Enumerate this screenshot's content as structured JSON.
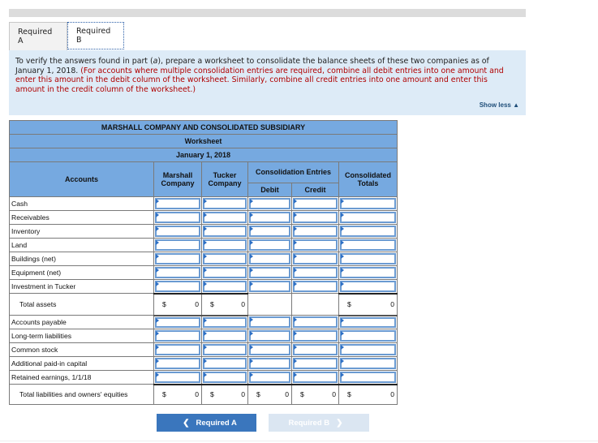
{
  "tabs": [
    {
      "label": "Required A",
      "active": false
    },
    {
      "label": "Required B",
      "active": true
    }
  ],
  "instructions": {
    "text_plain_1": "To verify the answers found in part (",
    "text_italic": "a",
    "text_plain_2": "), prepare a worksheet to consolidate the balance sheets of these two companies as of January 1, 2018. ",
    "text_red": "(For accounts where multiple consolidation entries are required, combine all debit entries into one amount and enter this amount in the debit column of the worksheet. Similarly, combine all credit entries into one amount and enter this amount in the credit column of the worksheet.)",
    "show_less_label": "Show less",
    "show_less_icon": "triangle-up-icon"
  },
  "worksheet": {
    "title": "MARSHALL COMPANY AND CONSOLIDATED SUBSIDIARY",
    "subtitle": "Worksheet",
    "date": "January 1, 2018",
    "headers": {
      "accounts": "Accounts",
      "marshall": "Marshall Company",
      "tucker": "Tucker Company",
      "consolidation_entries": "Consolidation Entries",
      "debit": "Debit",
      "credit": "Credit",
      "consolidated_totals": "Consolidated Totals"
    },
    "asset_rows": [
      {
        "account": "Cash",
        "marshall": "",
        "tucker": "",
        "debit": "",
        "credit": "",
        "consolidated": ""
      },
      {
        "account": "Receivables",
        "marshall": "",
        "tucker": "",
        "debit": "",
        "credit": "",
        "consolidated": ""
      },
      {
        "account": "Inventory",
        "marshall": "",
        "tucker": "",
        "debit": "",
        "credit": "",
        "consolidated": ""
      },
      {
        "account": "Land",
        "marshall": "",
        "tucker": "",
        "debit": "",
        "credit": "",
        "consolidated": ""
      },
      {
        "account": "Buildings (net)",
        "marshall": "",
        "tucker": "",
        "debit": "",
        "credit": "",
        "consolidated": ""
      },
      {
        "account": "Equipment (net)",
        "marshall": "",
        "tucker": "",
        "debit": "",
        "credit": "",
        "consolidated": ""
      },
      {
        "account": "Investment in Tucker",
        "marshall": "",
        "tucker": "",
        "debit": "",
        "credit": "",
        "consolidated": ""
      }
    ],
    "total_assets": {
      "label": "Total assets",
      "currency": "$",
      "marshall": "0",
      "tucker": "0",
      "consolidated": "0"
    },
    "liability_rows": [
      {
        "account": "Accounts payable",
        "marshall": "",
        "tucker": "",
        "debit": "",
        "credit": "",
        "consolidated": ""
      },
      {
        "account": "Long-term liabilities",
        "marshall": "",
        "tucker": "",
        "debit": "",
        "credit": "",
        "consolidated": ""
      },
      {
        "account": "Common stock",
        "marshall": "",
        "tucker": "",
        "debit": "",
        "credit": "",
        "consolidated": ""
      },
      {
        "account": "Additional paid-in capital",
        "marshall": "",
        "tucker": "",
        "debit": "",
        "credit": "",
        "consolidated": ""
      },
      {
        "account": "Retained earnings, 1/1/18",
        "marshall": "",
        "tucker": "",
        "debit": "",
        "credit": "",
        "consolidated": ""
      }
    ],
    "total_liabilities": {
      "label": "Total liabilities and owners' equities",
      "currency": "$",
      "marshall": "0",
      "tucker": "0",
      "debit": "0",
      "credit": "0",
      "consolidated": "0"
    }
  },
  "nav": {
    "prev_label": "Required A",
    "prev_icon": "chevron-left-icon",
    "next_label": "Required B",
    "next_icon": "chevron-right-icon",
    "next_disabled": true
  },
  "colors": {
    "header_bg": "#76a9e0",
    "instruction_bg": "#ddebf7",
    "instruction_red": "#b00000",
    "primary_button": "#3a76bd",
    "disabled_button": "#dbe6f2",
    "input_border": "#6b9bd2"
  }
}
